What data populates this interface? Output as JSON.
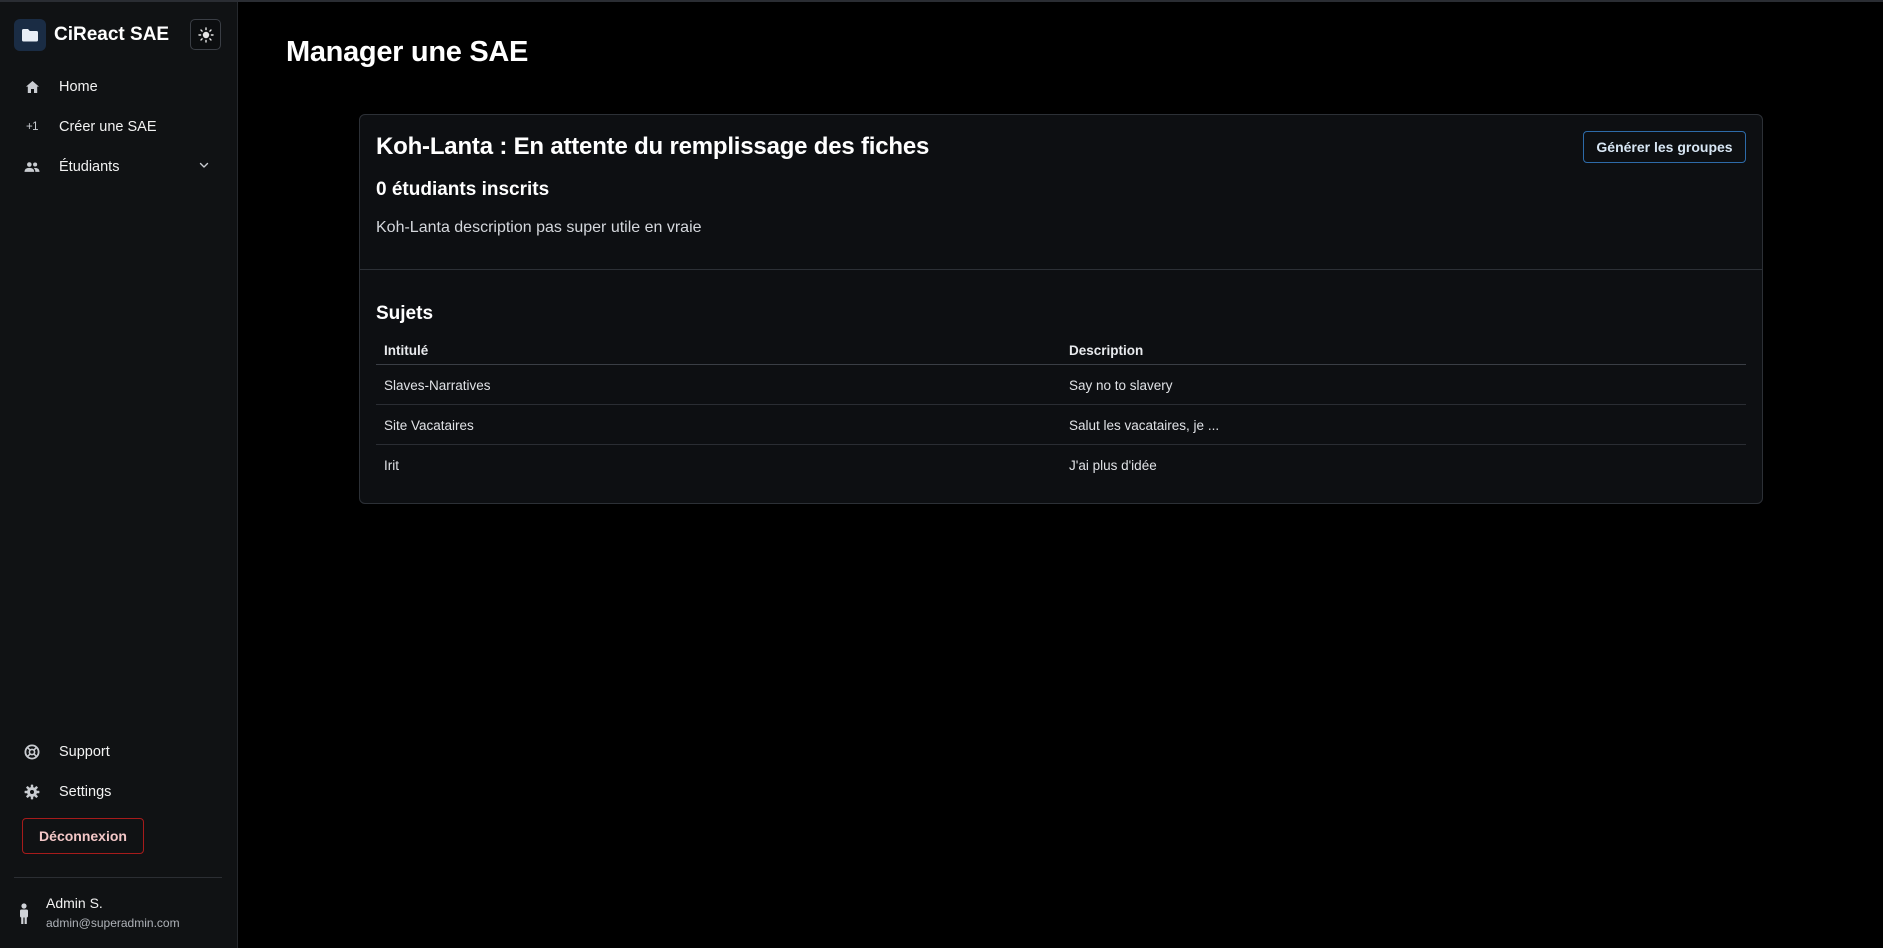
{
  "app": {
    "title": "CiReact SAE",
    "accent": "#2d6aa8",
    "danger": "#a61b1b"
  },
  "sidebar": {
    "items": [
      {
        "label": "Home",
        "icon": "home-icon"
      },
      {
        "label": "Créer une SAE",
        "icon": "plus-one-icon",
        "icon_text": "+1"
      },
      {
        "label": "Étudiants",
        "icon": "people-icon",
        "expandable": true
      }
    ],
    "bottom_items": [
      {
        "label": "Support",
        "icon": "support-icon"
      },
      {
        "label": "Settings",
        "icon": "gear-icon"
      }
    ],
    "logout_label": "Déconnexion",
    "user": {
      "name": "Admin S.",
      "email": "admin@superadmin.com"
    }
  },
  "main": {
    "page_title": "Manager une SAE",
    "card": {
      "title": "Koh-Lanta : En attente du remplissage des fiches",
      "generate_button": "Générer les groupes",
      "enrolled": "0 étudiants inscrits",
      "description": "Koh-Lanta description pas super utile en vraie",
      "subjects_title": "Sujets",
      "table": {
        "headers": [
          "Intitulé",
          "Description"
        ],
        "rows": [
          [
            "Slaves-Narratives",
            "Say no to slavery"
          ],
          [
            "Site Vacataires",
            "Salut les vacataires, je ..."
          ],
          [
            "Irit",
            "J'ai plus d'idée"
          ]
        ]
      }
    }
  }
}
